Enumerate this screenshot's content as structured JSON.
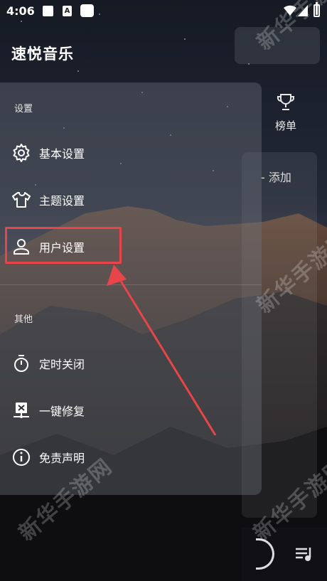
{
  "status_bar": {
    "time": "4:06"
  },
  "drawer": {
    "app_title": "速悦音乐",
    "sections": [
      {
        "title": "设置",
        "items": [
          {
            "label": "基本设置",
            "icon": "gear-icon"
          },
          {
            "label": "主题设置",
            "icon": "shirt-icon"
          },
          {
            "label": "用户设置",
            "icon": "user-icon"
          }
        ]
      },
      {
        "title": "其他",
        "items": [
          {
            "label": "定时关闭",
            "icon": "timer-icon"
          },
          {
            "label": "一键修复",
            "icon": "repair-icon"
          },
          {
            "label": "免责声明",
            "icon": "info-icon"
          }
        ]
      }
    ]
  },
  "underlay": {
    "tab_ranking": "榜单",
    "add_label": "添加"
  },
  "watermark": "新华手游网",
  "colors": {
    "highlight": "#e8454a",
    "accent_text": "#ffffff"
  }
}
